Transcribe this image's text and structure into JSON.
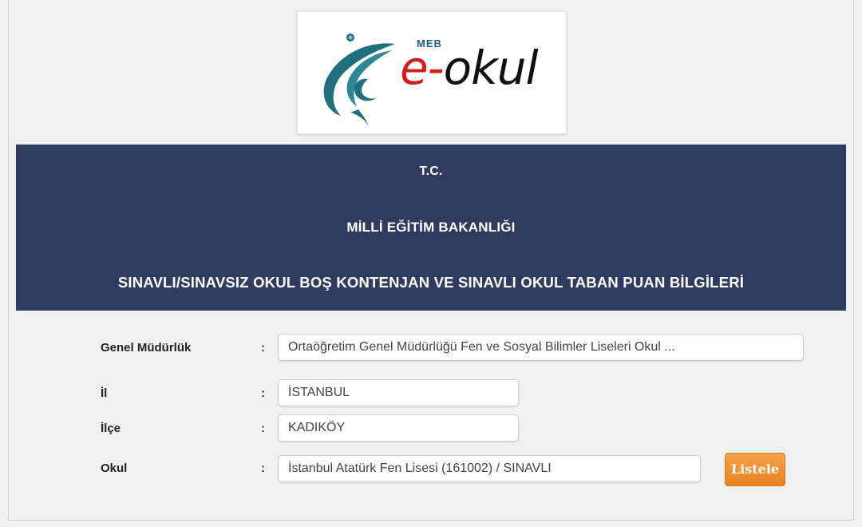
{
  "logo": {
    "brand_small": "MEB",
    "brand_prefix": "e-",
    "brand_main": "okul"
  },
  "banner": {
    "line1": "T.C.",
    "line2": "MİLLİ EĞİTİM BAKANLIĞI",
    "line3": "SINAVLI/SINAVSIZ OKUL BOŞ KONTENJAN VE SINAVLI OKUL TABAN PUAN BİLGİLERİ"
  },
  "form": {
    "colon": ":",
    "genel_mudurluk": {
      "label": "Genel Müdürlük",
      "value": "Ortaöğretim Genel Müdürlüğü Fen ve Sosyal Bilimler Liseleri Okul ..."
    },
    "il": {
      "label": "İl",
      "value": "İSTANBUL"
    },
    "ilce": {
      "label": "İlçe",
      "value": "KADIKÖY"
    },
    "okul": {
      "label": "Okul",
      "value": "İstanbul Atatürk Fen Lisesi (161002) / SINAVLI"
    },
    "submit_label": "Listele"
  },
  "colors": {
    "banner_bg": "#2f3c5f",
    "button_orange": "#ea8222",
    "logo_teal": "#1f6f7c",
    "logo_red": "#d11f1f"
  }
}
